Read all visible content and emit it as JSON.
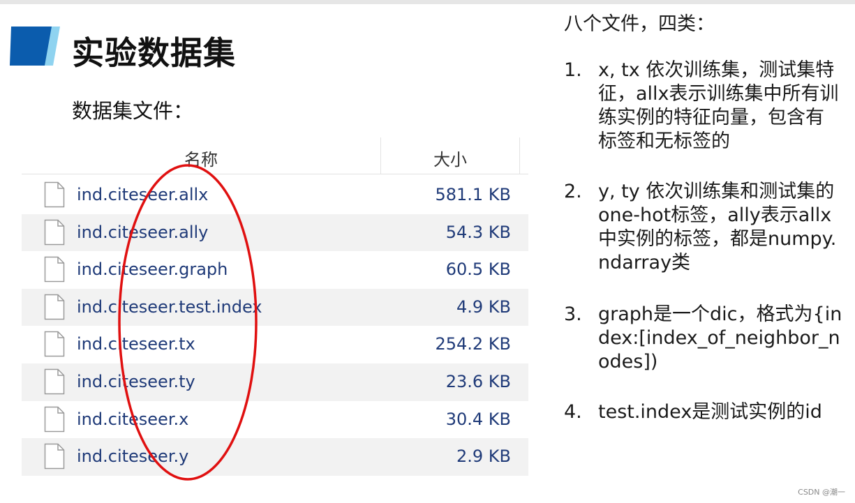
{
  "slide": {
    "title": "实验数据集",
    "subtitle": "数据集文件："
  },
  "table": {
    "headers": {
      "name": "名称",
      "size": "大小"
    },
    "rows": [
      {
        "name": "ind.citeseer.allx",
        "size": "581.1 KB"
      },
      {
        "name": "ind.citeseer.ally",
        "size": "54.3 KB"
      },
      {
        "name": "ind.citeseer.graph",
        "size": "60.5 KB"
      },
      {
        "name": "ind.citeseer.test.index",
        "size": "4.9 KB"
      },
      {
        "name": "ind.citeseer.tx",
        "size": "254.2 KB"
      },
      {
        "name": "ind.citeseer.ty",
        "size": "23.6 KB"
      },
      {
        "name": "ind.citeseer.x",
        "size": "30.4 KB"
      },
      {
        "name": "ind.citeseer.y",
        "size": "2.9 KB"
      }
    ]
  },
  "notes": {
    "heading": "八个文件，四类：",
    "items": [
      {
        "num": "1.",
        "text": "x, tx 依次训练集，测试集特征，allx表示训练集中所有训练实例的特征向量，包含有标签和无标签的"
      },
      {
        "num": "2.",
        "text": "y, ty 依次训练集和测试集的one-hot标签，ally表示allx中实例的标签，都是numpy.ndarray类"
      },
      {
        "num": "3.",
        "text": "graph是一个dic，格式为{index:[index_of_neighbor_nodes])"
      },
      {
        "num": "4.",
        "text": "test.index是测试实例的id"
      }
    ]
  },
  "watermark": "CSDN @潮一",
  "colors": {
    "title_mark_dark": "#0b5cad",
    "title_mark_light": "#8fd3f0",
    "file_text": "#1f3a78",
    "annotation_circle": "#e01010",
    "row_alt_bg": "#f2f2f2"
  },
  "icons": {
    "file": "document-icon",
    "title_mark": "parallelogram-mark"
  }
}
